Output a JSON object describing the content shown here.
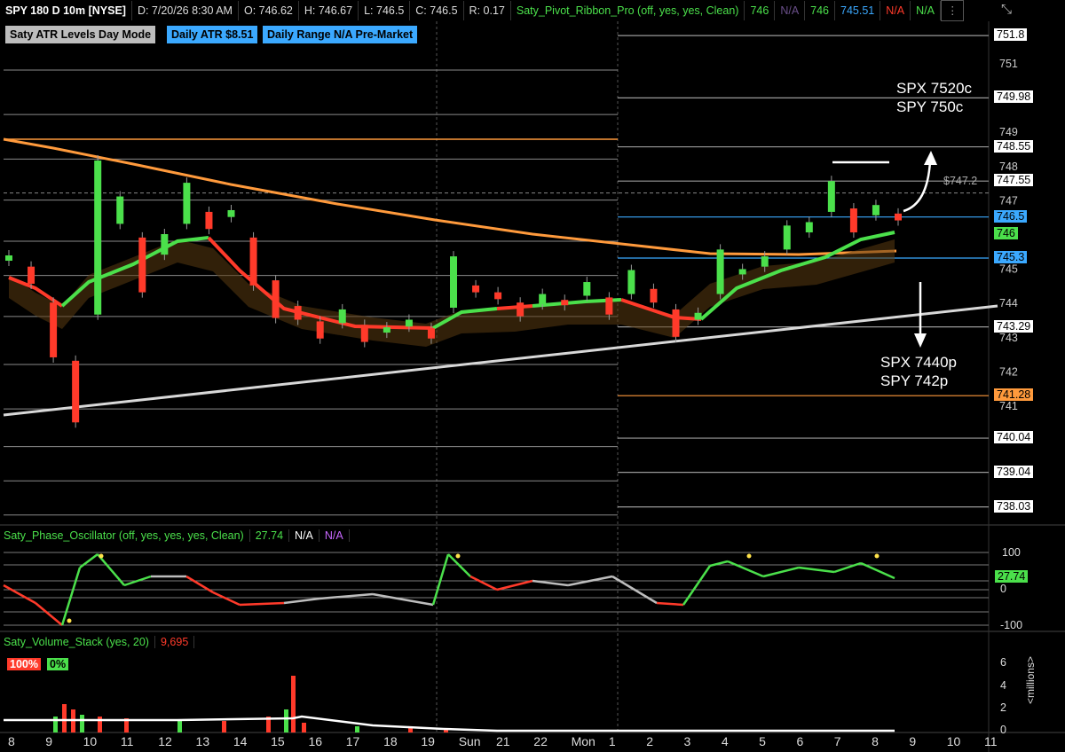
{
  "header": {
    "symbol": "SPY 180 D 10m [NYSE]",
    "datetime": "D: 7/20/26 8:30 AM",
    "open": "O: 746.62",
    "high": "H: 746.67",
    "low": "L: 746.5",
    "close": "C: 746.5",
    "range": "R: 0.17",
    "study": "Saty_Pivot_Ribbon_Pro (off, yes, yes, Clean)",
    "v1": "746",
    "v2": "N/A",
    "v3": "746",
    "v4": "745.51",
    "v5": "N/A",
    "v6": "N/A"
  },
  "pills": {
    "mode": "Saty ATR Levels Day Mode",
    "atr": "Daily ATR $8.51",
    "range": "Daily Range N/A Pre-Market"
  },
  "annotations": {
    "call1": "SPX 7520c",
    "call2": "SPY 750c",
    "put1": "SPX 7440p",
    "put2": "SPY 742p",
    "dashed_price": "$747.2"
  },
  "colors": {
    "green": "#4be04b",
    "red": "#ff3a2a",
    "gray": "#bdbdbd",
    "orange": "#ff9a3c",
    "blue": "#3ba9ff",
    "white": "#e6e6e6"
  },
  "oscillator": {
    "title": "Saty_Phase_Oscillator (off, yes, yes, yes, Clean)",
    "value": "27.74",
    "na1": "N/A",
    "na2": "N/A",
    "ticks": [
      "100",
      "0",
      "-100"
    ]
  },
  "volume": {
    "title": "Saty_Volume_Stack (yes, 20)",
    "value": "9,695",
    "pct_red": "100%",
    "pct_green": "0%",
    "unit": "<millions>",
    "ticks": [
      "6",
      "4",
      "2",
      "0"
    ]
  },
  "chart_data": {
    "type": "line",
    "title": "SPY 180 D 10m [NYSE]",
    "y_axis_ticks": [
      751,
      750,
      749,
      748,
      747,
      746,
      745,
      744,
      743,
      742,
      741
    ],
    "price_labels": [
      {
        "value": "751.8",
        "color": "#ffffff"
      },
      {
        "value": "749.98",
        "color": "#ffffff"
      },
      {
        "value": "748.55",
        "color": "#ffffff"
      },
      {
        "value": "747.55",
        "color": "#ffffff"
      },
      {
        "value": "746.5",
        "color": "#3ba9ff"
      },
      {
        "value": "746",
        "color": "#4be04b"
      },
      {
        "value": "745.3",
        "color": "#3ba9ff"
      },
      {
        "value": "743.29",
        "color": "#ffffff"
      },
      {
        "value": "741.28",
        "color": "#ff9a3c"
      },
      {
        "value": "740.04",
        "color": "#ffffff"
      },
      {
        "value": "739.04",
        "color": "#ffffff"
      },
      {
        "value": "738.03",
        "color": "#ffffff"
      }
    ],
    "x_tick_labels": [
      "8",
      "9",
      "10",
      "11",
      "12",
      "13",
      "14",
      "15",
      "16",
      "17",
      "18",
      "19",
      "Sun",
      "21",
      "22",
      "Mon",
      "1",
      "2",
      "3",
      "4",
      "5",
      "6",
      "7",
      "8",
      "9",
      "10",
      "11"
    ],
    "series": [
      {
        "values": [
          745.3,
          744.8,
          743.2,
          741.4,
          745.9,
          746.7,
          745.1,
          745.7,
          746.9,
          746.4,
          746.6,
          745.2,
          744.1,
          743.7,
          743.2,
          743.6,
          743.1,
          743.2,
          743.4,
          743.1,
          744.6,
          744.4,
          744.2,
          743.8,
          744.1,
          744.0,
          744.4,
          743.9,
          744.6,
          744.2,
          743.4,
          743.6,
          744.9,
          744.9,
          745.2,
          745.9,
          746.2,
          747.1,
          746.4,
          746.7,
          746.5
        ]
      }
    ],
    "ylim": [
      737.5,
      752.2
    ]
  }
}
